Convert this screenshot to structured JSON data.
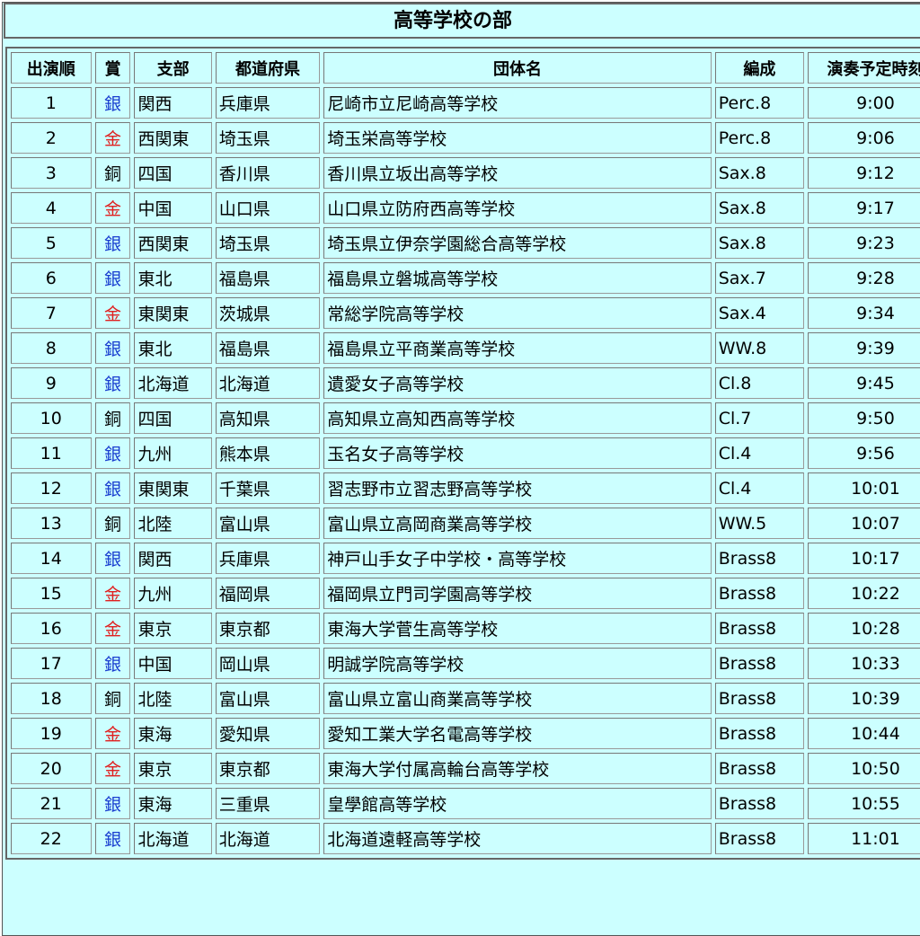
{
  "title": "高等学校の部",
  "columns": [
    "出演順",
    "賞",
    "支部",
    "都道府県",
    "団体名",
    "編成",
    "演奏予定時刻"
  ],
  "award_colors": {
    "金": "#e02020",
    "銀": "#1a3ed0",
    "銅": "#000000"
  },
  "rows": [
    {
      "order": "1",
      "award": "銀",
      "branch": "関西",
      "pref": "兵庫県",
      "name": "尼崎市立尼崎高等学校",
      "form": "Perc.8",
      "time": "9:00"
    },
    {
      "order": "2",
      "award": "金",
      "branch": "西関東",
      "pref": "埼玉県",
      "name": "埼玉栄高等学校",
      "form": "Perc.8",
      "time": "9:06"
    },
    {
      "order": "3",
      "award": "銅",
      "branch": "四国",
      "pref": "香川県",
      "name": "香川県立坂出高等学校",
      "form": "Sax.8",
      "time": "9:12"
    },
    {
      "order": "4",
      "award": "金",
      "branch": "中国",
      "pref": "山口県",
      "name": "山口県立防府西高等学校",
      "form": "Sax.8",
      "time": "9:17"
    },
    {
      "order": "5",
      "award": "銀",
      "branch": "西関東",
      "pref": "埼玉県",
      "name": "埼玉県立伊奈学園総合高等学校",
      "form": "Sax.8",
      "time": "9:23"
    },
    {
      "order": "6",
      "award": "銀",
      "branch": "東北",
      "pref": "福島県",
      "name": "福島県立磐城高等学校",
      "form": "Sax.7",
      "time": "9:28"
    },
    {
      "order": "7",
      "award": "金",
      "branch": "東関東",
      "pref": "茨城県",
      "name": "常総学院高等学校",
      "form": "Sax.4",
      "time": "9:34"
    },
    {
      "order": "8",
      "award": "銀",
      "branch": "東北",
      "pref": "福島県",
      "name": "福島県立平商業高等学校",
      "form": "WW.8",
      "time": "9:39"
    },
    {
      "order": "9",
      "award": "銀",
      "branch": "北海道",
      "pref": "北海道",
      "name": "遺愛女子高等学校",
      "form": "Cl.8",
      "time": "9:45"
    },
    {
      "order": "10",
      "award": "銅",
      "branch": "四国",
      "pref": "高知県",
      "name": "高知県立高知西高等学校",
      "form": "Cl.7",
      "time": "9:50"
    },
    {
      "order": "11",
      "award": "銀",
      "branch": "九州",
      "pref": "熊本県",
      "name": "玉名女子高等学校",
      "form": "Cl.4",
      "time": "9:56"
    },
    {
      "order": "12",
      "award": "銀",
      "branch": "東関東",
      "pref": "千葉県",
      "name": "習志野市立習志野高等学校",
      "form": "Cl.4",
      "time": "10:01"
    },
    {
      "order": "13",
      "award": "銅",
      "branch": "北陸",
      "pref": "富山県",
      "name": "富山県立高岡商業高等学校",
      "form": "WW.5",
      "time": "10:07"
    },
    {
      "order": "14",
      "award": "銀",
      "branch": "関西",
      "pref": "兵庫県",
      "name": "神戸山手女子中学校・高等学校",
      "form": "Brass8",
      "time": "10:17"
    },
    {
      "order": "15",
      "award": "金",
      "branch": "九州",
      "pref": "福岡県",
      "name": "福岡県立門司学園高等学校",
      "form": "Brass8",
      "time": "10:22"
    },
    {
      "order": "16",
      "award": "金",
      "branch": "東京",
      "pref": "東京都",
      "name": "東海大学菅生高等学校",
      "form": "Brass8",
      "time": "10:28"
    },
    {
      "order": "17",
      "award": "銀",
      "branch": "中国",
      "pref": "岡山県",
      "name": "明誠学院高等学校",
      "form": "Brass8",
      "time": "10:33"
    },
    {
      "order": "18",
      "award": "銅",
      "branch": "北陸",
      "pref": "富山県",
      "name": "富山県立富山商業高等学校",
      "form": "Brass8",
      "time": "10:39"
    },
    {
      "order": "19",
      "award": "金",
      "branch": "東海",
      "pref": "愛知県",
      "name": "愛知工業大学名電高等学校",
      "form": "Brass8",
      "time": "10:44"
    },
    {
      "order": "20",
      "award": "金",
      "branch": "東京",
      "pref": "東京都",
      "name": "東海大学付属高輪台高等学校",
      "form": "Brass8",
      "time": "10:50"
    },
    {
      "order": "21",
      "award": "銀",
      "branch": "東海",
      "pref": "三重県",
      "name": "皇學館高等学校",
      "form": "Brass8",
      "time": "10:55"
    },
    {
      "order": "22",
      "award": "銀",
      "branch": "北海道",
      "pref": "北海道",
      "name": "北海道遠軽高等学校",
      "form": "Brass8",
      "time": "11:01"
    }
  ]
}
